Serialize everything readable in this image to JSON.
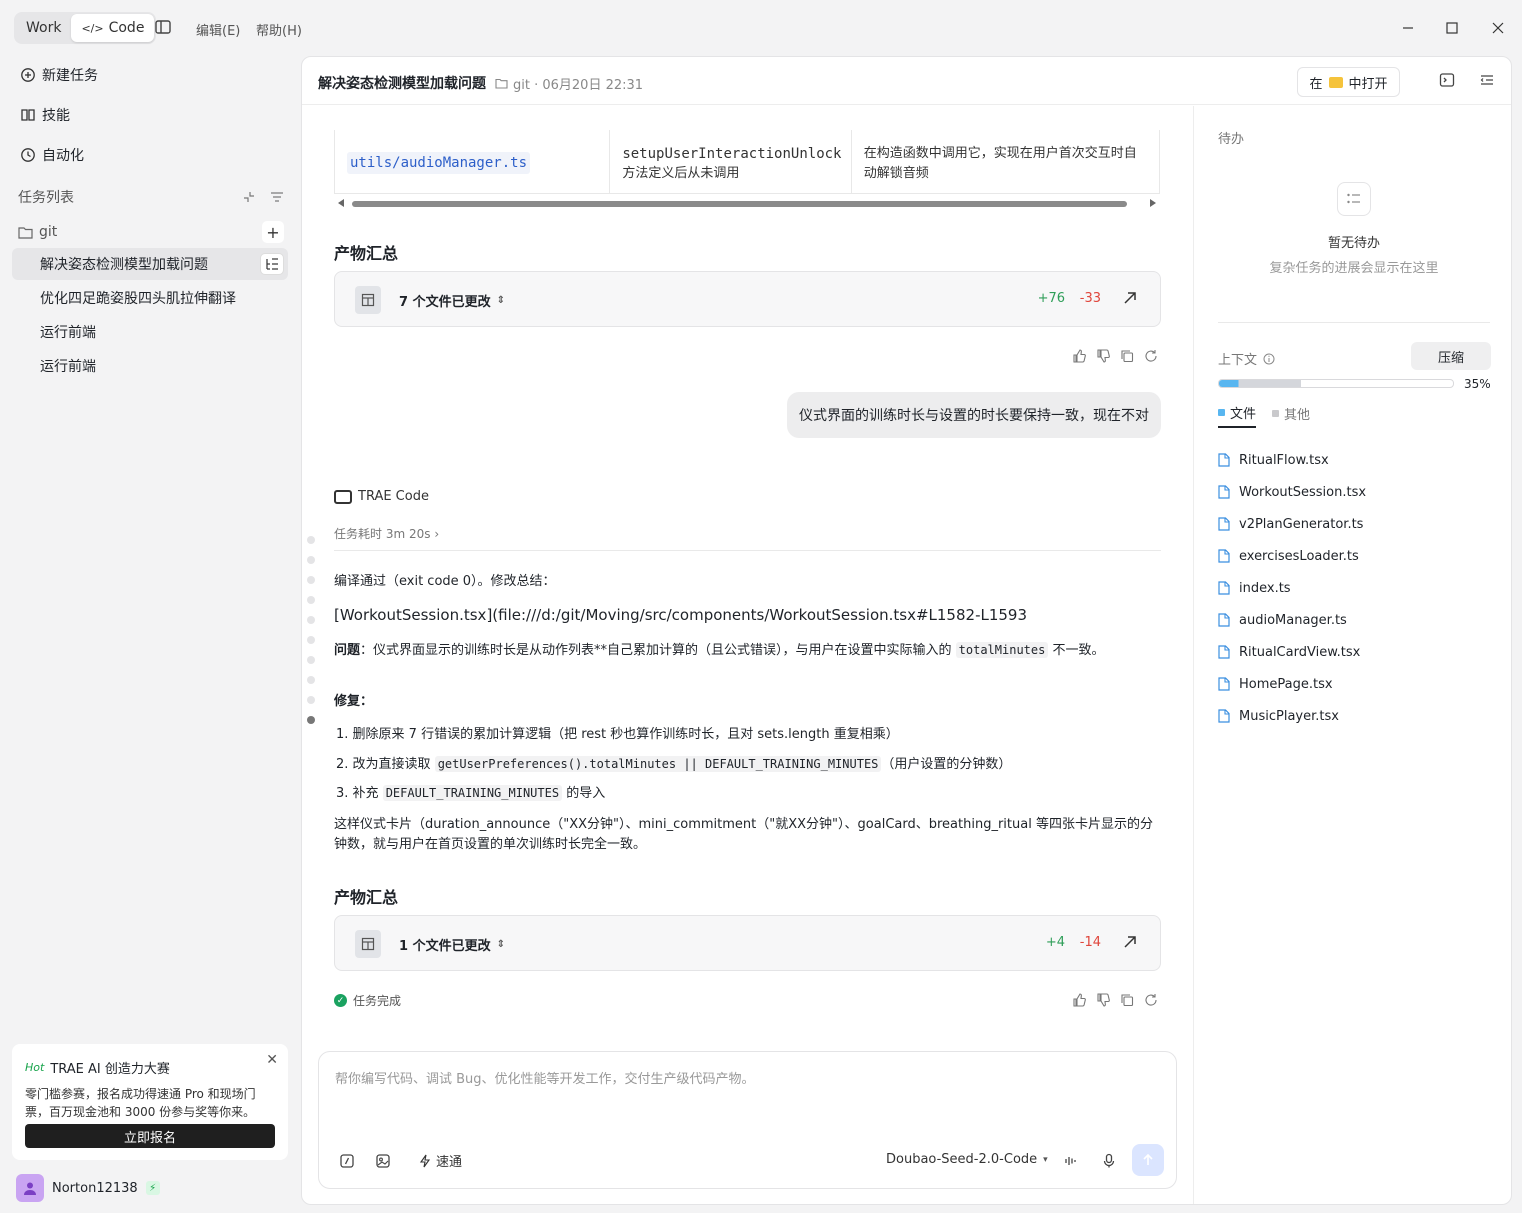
{
  "topbar": {
    "mode_work": "Work",
    "mode_code": "Code",
    "menu_edit": "编辑(E)",
    "menu_help": "帮助(H)"
  },
  "sidebar": {
    "nav": [
      {
        "label": "新建任务",
        "icon": "new-task-icon"
      },
      {
        "label": "技能",
        "icon": "book-icon"
      },
      {
        "label": "自动化",
        "icon": "clock-icon"
      }
    ],
    "task_list_label": "任务列表",
    "folder": "git",
    "tasks": [
      {
        "label": "解决姿态检测模型加载问题",
        "active": true
      },
      {
        "label": "优化四足跪姿股四头肌拉伸翻译",
        "active": false
      },
      {
        "label": "运行前端",
        "active": false
      },
      {
        "label": "运行前端",
        "active": false
      }
    ],
    "promo": {
      "hot": "Hot",
      "title": "TRAE AI 创造力大赛",
      "desc": "零门槛参赛，报名成功得速通 Pro 和现场门票，百万现金池和 3000 份参与奖等你来。",
      "button": "立即报名"
    },
    "user": {
      "name": "Norton12138"
    }
  },
  "main": {
    "header": {
      "title": "解决姿态检测模型加载问题",
      "meta": "git · 06月20日 22:31",
      "open_in_prefix": "在",
      "open_in_suffix": "中打开"
    },
    "table_row": {
      "path": "utils/audioManager.ts",
      "method": "setupUserInteractionUnlock",
      "method_note": "方法定义后从未调用",
      "fix": "在构造函数中调用它，实现在用户首次交互时自动解锁音频"
    },
    "summary_1": {
      "heading": "产物汇总",
      "label": "7 个文件已更改",
      "added": "+76",
      "removed": "-33"
    },
    "user_message": "仪式界面的训练时长与设置的时长要保持一致，现在不对",
    "agent_name": "TRAE Code",
    "duration": "任务耗时 3m 20s",
    "reply": {
      "intro": "编译通过（exit code 0）。修改总结：",
      "link": "[WorkoutSession.tsx](file:///d:/git/Moving/src/components/WorkoutSession.tsx#L1582-L1593",
      "problem_label": "问题",
      "problem_text_a": "：仪式界面显示的训练时长是从动作列表**自己累加计算的（且公式错误），与用户在设置中实际输入的 ",
      "problem_code": "totalMinutes",
      "problem_text_b": " 不一致。",
      "fix_label": "修复",
      "fix_colon": "：",
      "step1": "删除原来 7 行错误的累加计算逻辑（把 rest 秒也算作训练时长，且对 sets.length 重复相乘）",
      "step2_a": "改为直接读取 ",
      "step2_code": "getUserPreferences().totalMinutes || DEFAULT_TRAINING_MINUTES",
      "step2_b": "（用户设置的分钟数）",
      "step3_a": "补充 ",
      "step3_code": "DEFAULT_TRAINING_MINUTES",
      "step3_b": " 的导入",
      "closing": "这样仪式卡片（duration_announce（\"XX分钟\"）、mini_commitment（\"就XX分钟\"）、goalCard、breathing_ritual 等四张卡片显示的分钟数，就与用户在首页设置的单次训练时长完全一致。"
    },
    "summary_2": {
      "heading": "产物汇总",
      "label": "1 个文件已更改",
      "added": "+4",
      "removed": "-14"
    },
    "status": "任务完成",
    "composer": {
      "placeholder": "帮你编写代码、调试 Bug、优化性能等开发工作，交付生产级代码产物。",
      "speed": "速通",
      "model": "Doubao-Seed-2.0-Code"
    }
  },
  "side": {
    "todo_heading": "待办",
    "empty_title": "暂无待办",
    "empty_sub": "复杂任务的进展会显示在这里",
    "context_heading": "上下文",
    "compress": "压缩",
    "context_progress": 0.35,
    "context_pct": "35%",
    "tab_files": "文件",
    "tab_other": "其他",
    "files": [
      "RitualFlow.tsx",
      "WorkoutSession.tsx",
      "v2PlanGenerator.ts",
      "exercisesLoader.ts",
      "index.ts",
      "audioManager.ts",
      "RitualCardView.tsx",
      "HomePage.tsx",
      "MusicPlayer.tsx"
    ]
  },
  "colors": {
    "added": "#2e9e58",
    "removed": "#e0463c",
    "accent": "#58b6f0",
    "link": "#2d5fc9"
  }
}
